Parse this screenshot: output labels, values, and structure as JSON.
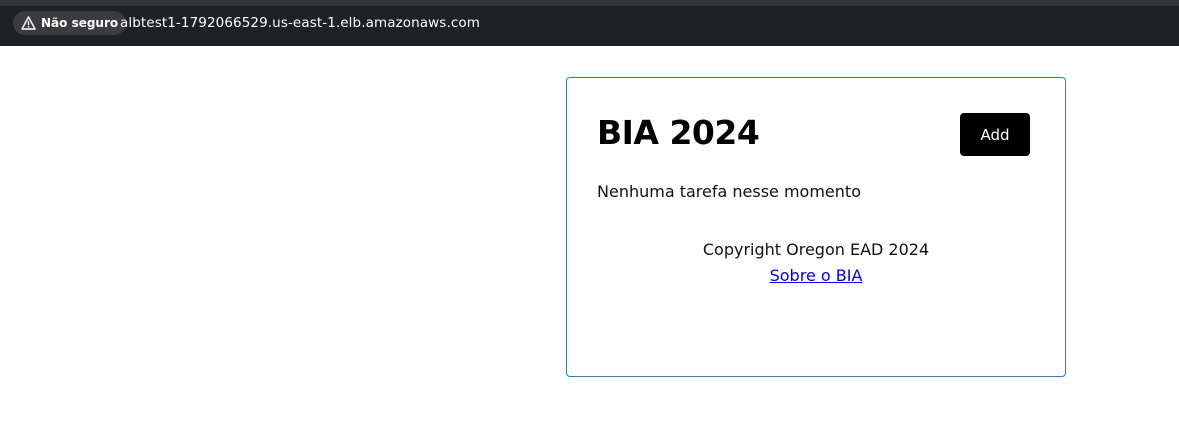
{
  "browser": {
    "security_label": "Não seguro",
    "url": "albtest1-1792066529.us-east-1.elb.amazonaws.com",
    "security_icon": "warning-triangle-icon"
  },
  "app": {
    "title": "BIA 2024",
    "add_label": "Add",
    "empty_message": "Nenhuma tarefa nesse momento",
    "copyright": "Copyright Oregon EAD 2024",
    "about_link": "Sobre o BIA"
  },
  "colors": {
    "card_border": "#3b79b7",
    "button_bg": "#000000",
    "link": "#0000ee",
    "topbar_bg": "#202124"
  }
}
